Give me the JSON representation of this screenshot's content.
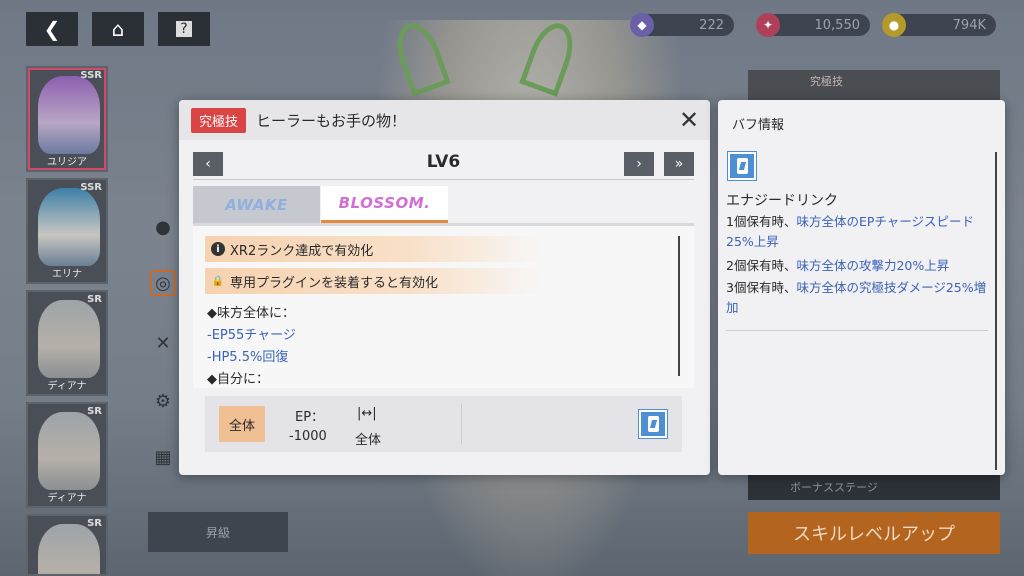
{
  "background": {
    "currencies": [
      {
        "icon": "gem-icon",
        "value": "222"
      },
      {
        "icon": "crystal-icon",
        "value": "10,550"
      },
      {
        "icon": "coin-icon",
        "value": "794K"
      }
    ],
    "characters": [
      {
        "rarity": "SSR",
        "name": "ユリジア",
        "selected": true
      },
      {
        "rarity": "SSR",
        "name": "エリナ",
        "selected": false
      },
      {
        "rarity": "SR",
        "name": "ディアナ",
        "selected": false
      },
      {
        "rarity": "SR",
        "name": "ディアナ",
        "selected": false
      },
      {
        "rarity": "SR",
        "name": "",
        "selected": false
      }
    ],
    "bottom_button": "昇級",
    "ultimate_tag": "究極技",
    "bonus_stage": "ボーナスステージ",
    "level_up_button": "スキルレベルアップ"
  },
  "skill_modal": {
    "badge": "究極技",
    "title": "ヒーラーもお手の物！",
    "level": "LV6",
    "tabs": [
      {
        "label": "AWAKE",
        "active": false
      },
      {
        "label": "BLOSSOM.",
        "active": true
      }
    ],
    "conditions": [
      {
        "icon": "info-icon",
        "text": "XR2ランク達成で有効化"
      },
      {
        "icon": "lock-icon",
        "text": "専用プラグインを装着すると有効化"
      }
    ],
    "description": [
      {
        "text": "◆味方全体に：",
        "highlight": false
      },
      {
        "text": "-EP55チャージ",
        "highlight": true
      },
      {
        "text": "-HP5.5%回復",
        "highlight": true
      },
      {
        "text": "◆自分に：",
        "highlight": false
      }
    ],
    "footer": {
      "target": "全体",
      "ep_label": "EP：",
      "ep_value": "-1000",
      "range_label": "全体"
    }
  },
  "buff_panel": {
    "title": "バフ情報",
    "buff_name": "エナジードリンク",
    "lines": [
      {
        "prefix": "1個保有時、",
        "effect": "味方全体のEPチャージスピード25%上昇"
      },
      {
        "prefix": "2個保有時、",
        "effect": "味方全体の攻撃力20%上昇"
      },
      {
        "prefix": "3個保有時、",
        "effect": "味方全体の究極技ダメージ25%増加"
      }
    ]
  },
  "colors": {
    "ult_badge": "#d94545",
    "highlight_text": "#3a62b9",
    "condition_bg": "#f6d2b0",
    "tab_active_underline": "#e58a3c",
    "blossom_text": "#d26fd3"
  }
}
